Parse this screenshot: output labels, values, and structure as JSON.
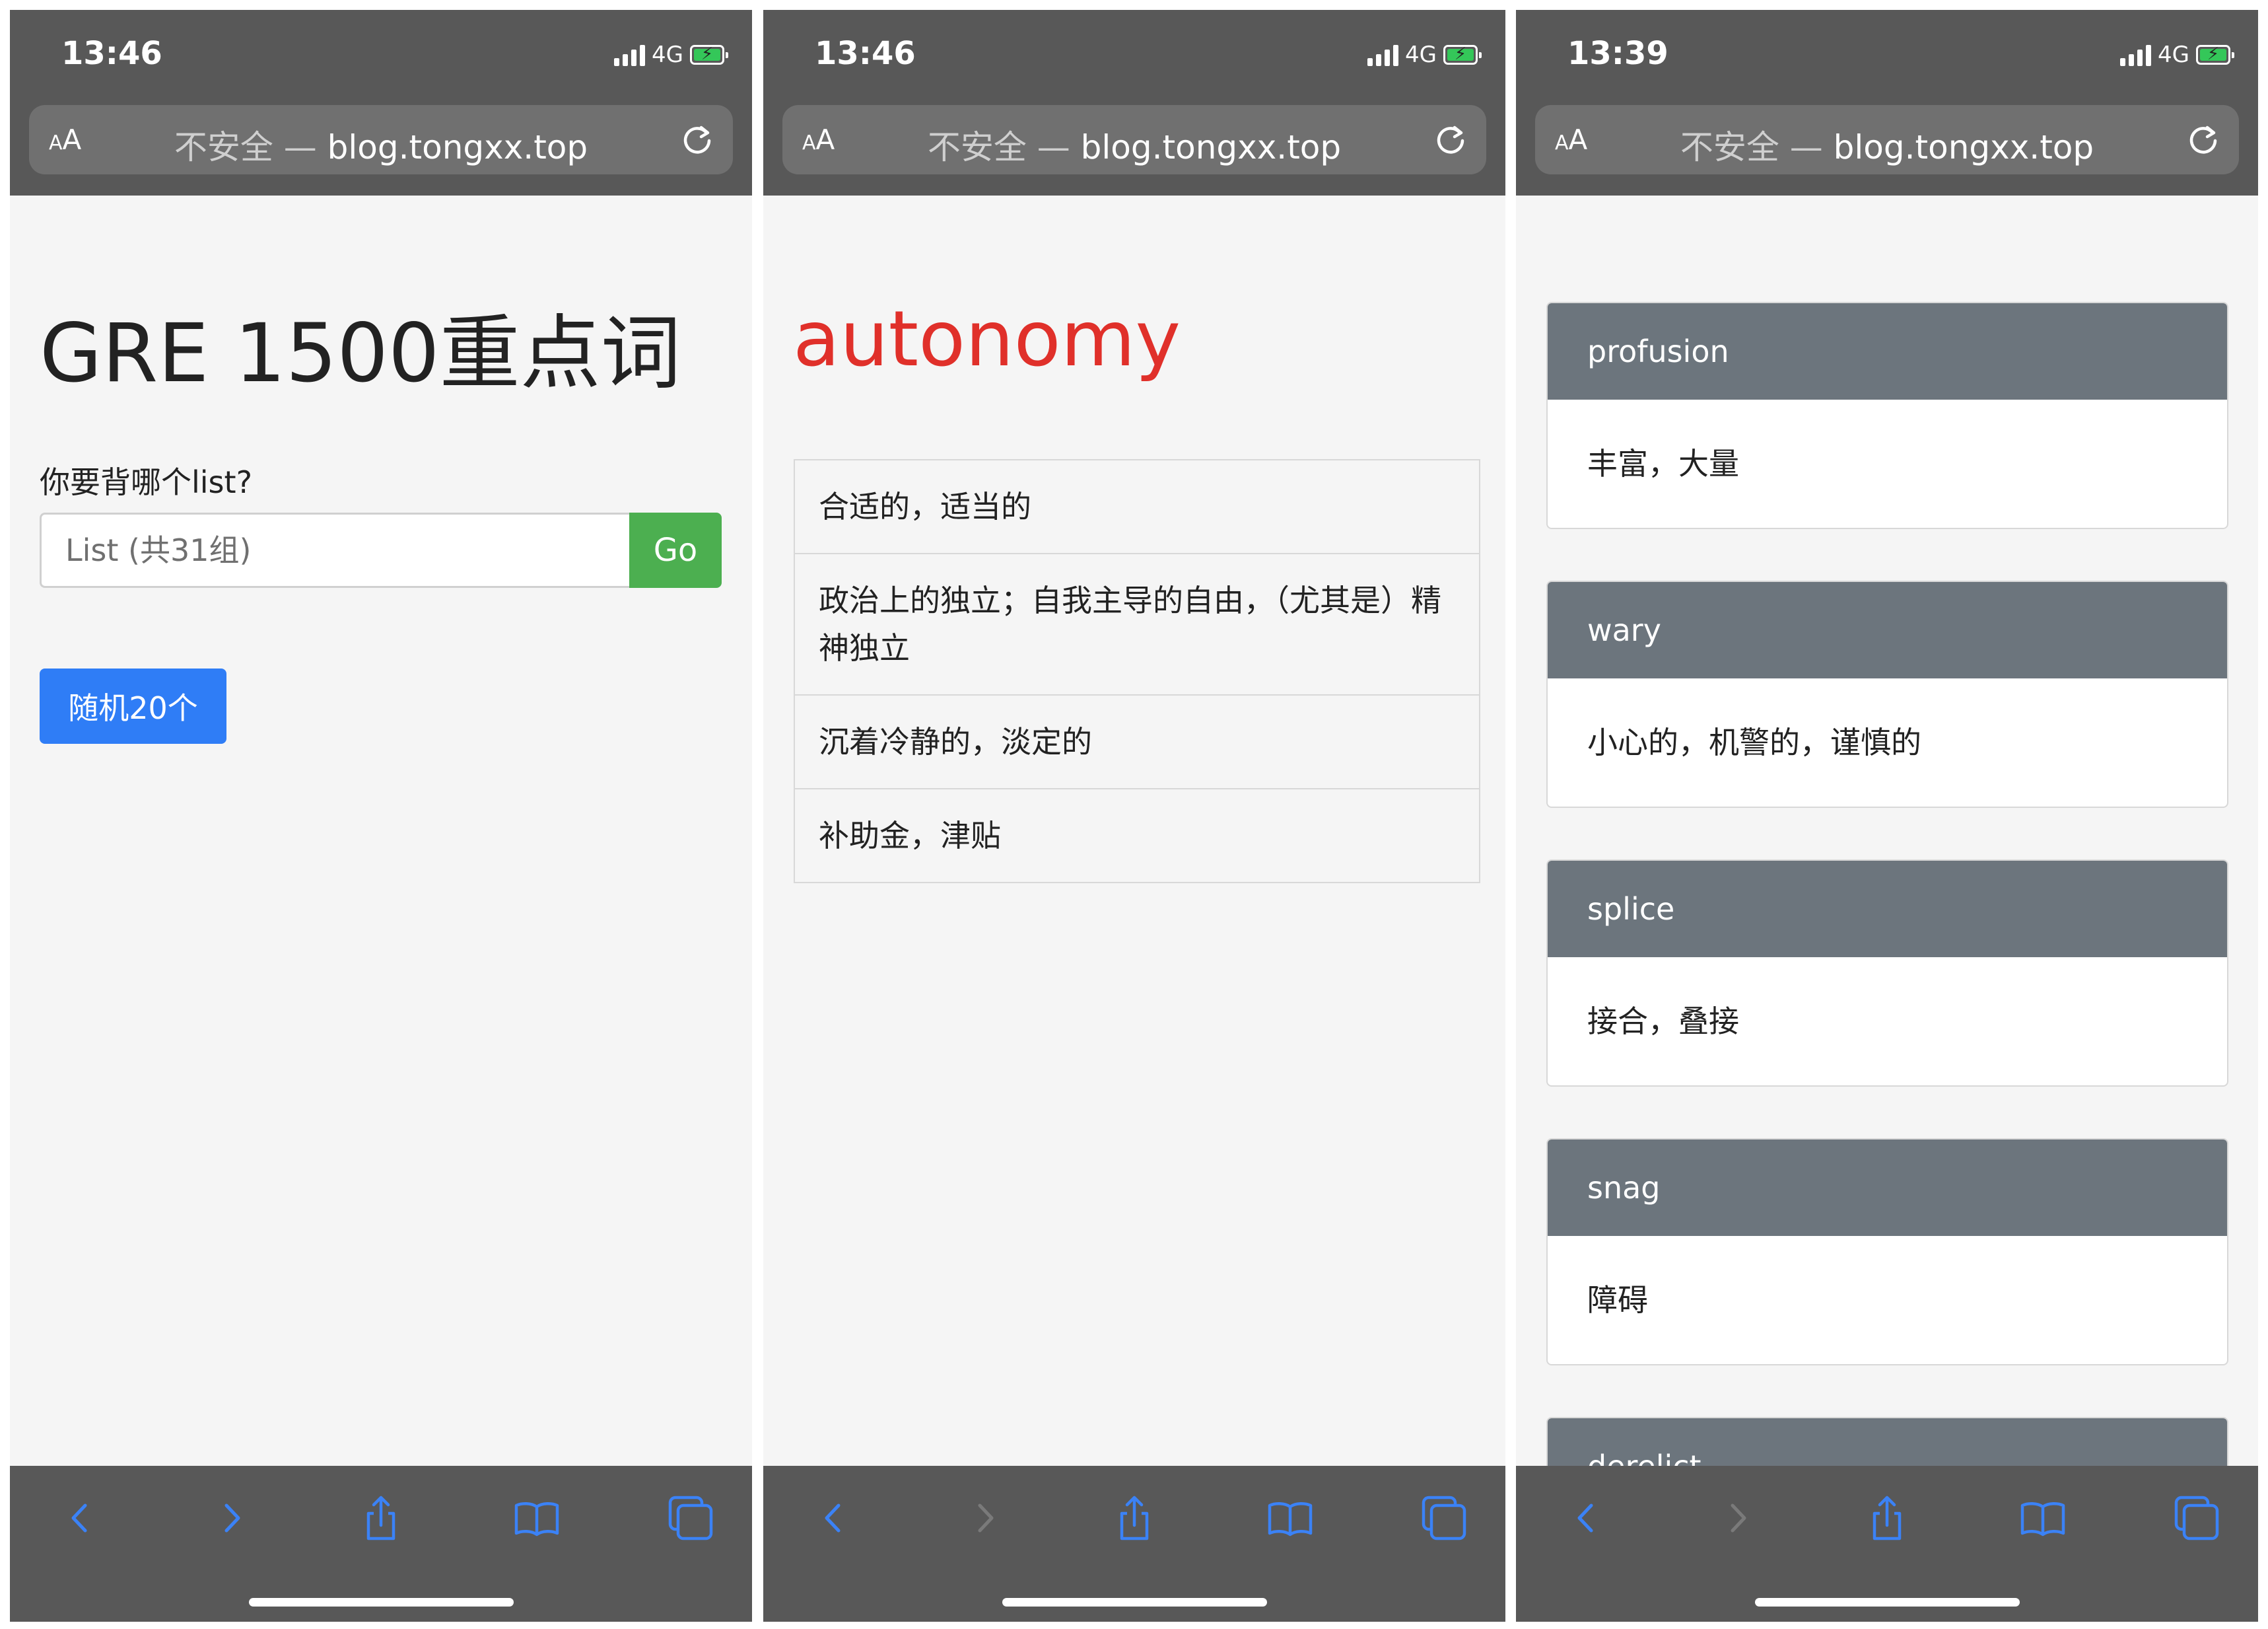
{
  "colors": {
    "accent": "#3b82f6",
    "success": "#4caf50",
    "word_red": "#e0302a",
    "card_header": "#6c757d"
  },
  "panels": [
    {
      "status": {
        "time": "13:46",
        "network": "4G"
      },
      "url": {
        "aa_small": "A",
        "aa_large": "A",
        "insecure": "不安全 — ",
        "domain": "blog.tongxx.top"
      },
      "heading": "GRE 1500重点词",
      "question": "你要背哪个list?",
      "input_placeholder": "List (共31组)",
      "go_label": "Go",
      "random_label": "随机20个",
      "toolbar": {
        "back": "back-icon",
        "forward": "forward-icon",
        "share": "share-icon",
        "bookmarks": "bookmarks-icon",
        "tabs": "tabs-icon"
      }
    },
    {
      "status": {
        "time": "13:46",
        "network": "4G"
      },
      "url": {
        "aa_small": "A",
        "aa_large": "A",
        "insecure": "不安全 — ",
        "domain": "blog.tongxx.top"
      },
      "word": "autonomy",
      "meanings": [
        "合适的，适当的",
        "政治上的独立；自我主导的自由，（尤其是）精神独立",
        "沉着冷静的，淡定的",
        "补助金，津贴"
      ]
    },
    {
      "status": {
        "time": "13:39",
        "network": "4G"
      },
      "url": {
        "aa_small": "A",
        "aa_large": "A",
        "insecure": "不安全 — ",
        "domain": "blog.tongxx.top"
      },
      "cards": [
        {
          "word": "profusion",
          "meaning": "丰富，大量"
        },
        {
          "word": "wary",
          "meaning": "小心的，机警的，谨慎的"
        },
        {
          "word": "splice",
          "meaning": "接合，叠接"
        },
        {
          "word": "snag",
          "meaning": "障碍"
        },
        {
          "word": "derelict",
          "meaning": ""
        }
      ]
    }
  ]
}
